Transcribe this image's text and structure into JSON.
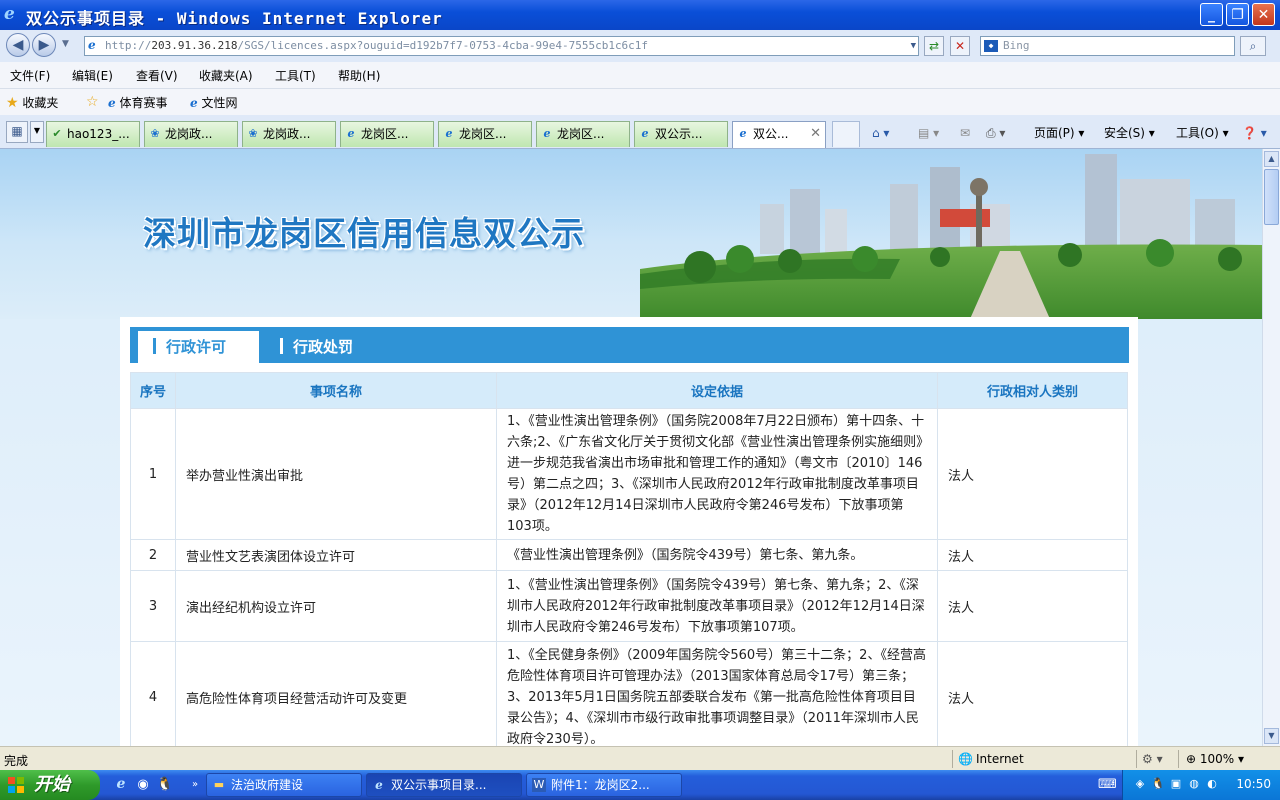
{
  "window": {
    "title": "双公示事项目录 - Windows Internet Explorer",
    "minimize": "_",
    "maximize": "❐",
    "close": "✕"
  },
  "address": {
    "url_prefix": "http://",
    "url_host": "203.91.36.218",
    "url_path": "/SGS/licences.aspx?ouguid=d192b7f7-0753-4cba-99e4-7555cb1c6c1f",
    "search_placeholder": "Bing"
  },
  "menu": [
    "文件(F)",
    "编辑(E)",
    "查看(V)",
    "收藏夹(A)",
    "工具(T)",
    "帮助(H)"
  ],
  "favorites": {
    "label": "收藏夹",
    "items": [
      "体育赛事",
      "文性网"
    ]
  },
  "browser_tabs": [
    {
      "label": "hao123_..."
    },
    {
      "label": "龙岗政..."
    },
    {
      "label": "龙岗政..."
    },
    {
      "label": "龙岗区..."
    },
    {
      "label": "龙岗区..."
    },
    {
      "label": "龙岗区..."
    },
    {
      "label": "双公示..."
    },
    {
      "label": "双公..."
    }
  ],
  "commands": {
    "page": "页面(P)",
    "safety": "安全(S)",
    "tools": "工具(O)"
  },
  "page": {
    "banner_title": "深圳市龙岗区信用信息双公示",
    "tabs": {
      "active": "行政许可",
      "inactive": "行政处罚"
    },
    "table": {
      "headers": [
        "序号",
        "事项名称",
        "设定依据",
        "行政相对人类别"
      ],
      "rows": [
        {
          "no": "1",
          "name": "举办营业性演出审批",
          "basis": "1、《营业性演出管理条例》（国务院2008年7月22日颁布）第十四条、十六条;2、《广东省文化厅关于贯彻文化部《营业性演出管理条例实施细则》进一步规范我省演出市场审批和管理工作的通知》（粤文市〔2010〕146号）第二点之四；3、《深圳市人民政府2012年行政审批制度改革事项目录》（2012年12月14日深圳市人民政府令第246号发布）下放事项第103项。",
          "type": "法人"
        },
        {
          "no": "2",
          "name": "营业性文艺表演团体设立许可",
          "basis": "《营业性演出管理条例》（国务院令439号）第七条、第九条。",
          "type": "法人"
        },
        {
          "no": "3",
          "name": "演出经纪机构设立许可",
          "basis": "1、《营业性演出管理条例》（国务院令439号）第七条、第九条；2、《深圳市人民政府2012年行政审批制度改革事项目录》（2012年12月14日深圳市人民政府令第246号发布）下放事项第107项。",
          "type": "法人"
        },
        {
          "no": "4",
          "name": "高危险性体育项目经营活动许可及变更",
          "basis": "1、《全民健身条例》（2009年国务院令560号）第三十二条；2、《经营高危险性体育项目许可管理办法》（2013国家体育总局令17号）第三条；3、2013年5月1日国务院五部委联合发布《第一批高危险性体育项目目录公告》；4、《深圳市市级行政审批事项调整目录》（2011年深圳市人民政府令230号）。",
          "type": "法人"
        }
      ]
    }
  },
  "status": {
    "text": "完成",
    "zone": "Internet",
    "zoom": "100%"
  },
  "taskbar": {
    "start": "开始",
    "tasks": [
      "法治政府建设",
      "双公示事项目录...",
      "附件1：龙岗区2..."
    ],
    "clock": "10:50"
  }
}
